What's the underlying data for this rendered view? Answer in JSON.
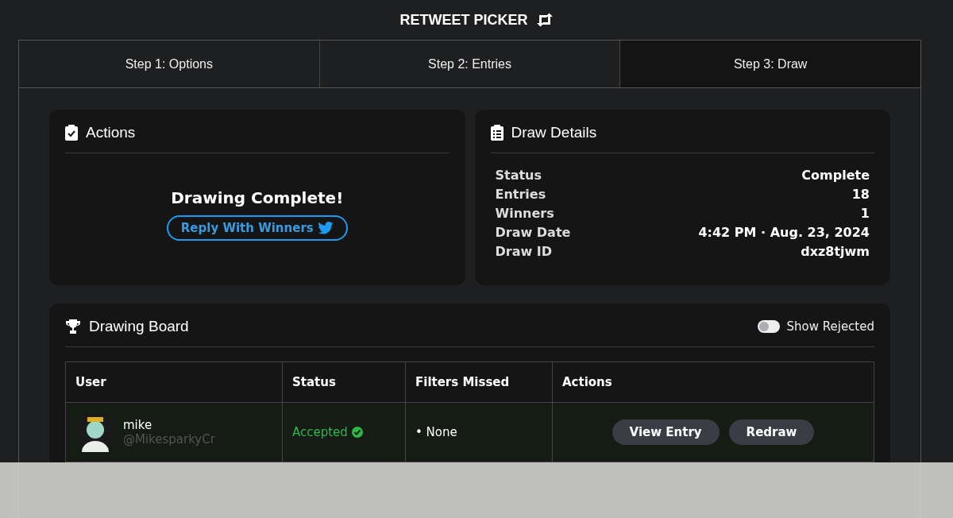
{
  "header": {
    "title": "RETWEET PICKER"
  },
  "tabs": [
    {
      "label": "Step 1: Options",
      "selected": false
    },
    {
      "label": "Step 2: Entries",
      "selected": false
    },
    {
      "label": "Step 3: Draw",
      "selected": true
    }
  ],
  "actions_card": {
    "title": "Actions",
    "message": "Drawing Complete!",
    "button": "Reply With Winners"
  },
  "details_card": {
    "title": "Draw Details",
    "rows": [
      {
        "label": "Status",
        "value": "Complete"
      },
      {
        "label": "Entries",
        "value": "18"
      },
      {
        "label": "Winners",
        "value": "1"
      },
      {
        "label": "Draw Date",
        "value": "4:42 PM · Aug. 23, 2024"
      },
      {
        "label": "Draw ID",
        "value": "dxz8tjwm"
      }
    ]
  },
  "board": {
    "title": "Drawing Board",
    "show_rejected": {
      "label": "Show Rejected",
      "on": false
    },
    "table": {
      "columns": [
        "User",
        "Status",
        "Filters Missed",
        "Actions"
      ],
      "rows": [
        {
          "name": "mike",
          "handle": "@MikesparkyCr",
          "status": "Accepted",
          "accepted": true,
          "filters_missed": "• None",
          "buttons": [
            "View Entry",
            "Redraw"
          ]
        }
      ]
    }
  }
}
